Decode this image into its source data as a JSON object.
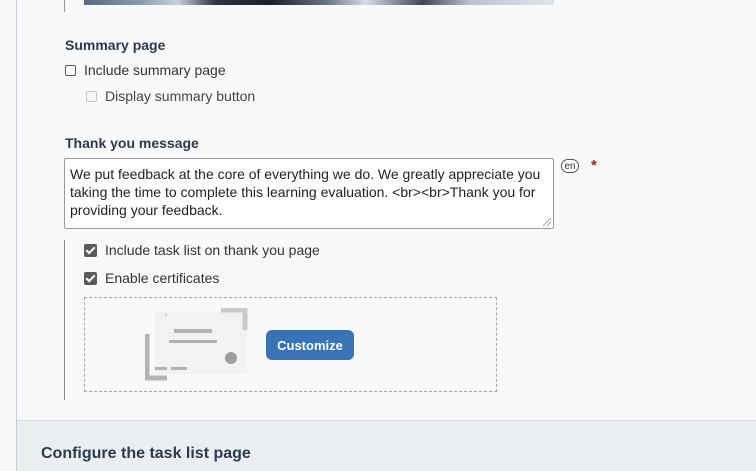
{
  "summary_section": {
    "title": "Summary page",
    "include_summary_label": "Include summary page",
    "display_button_label": "Display summary button"
  },
  "thank_you_section": {
    "title": "Thank you message",
    "message": "We put feedback at the core of everything we do. We greatly appreciate you taking the time to complete this learning evaluation. <br><br>Thank you for providing your feedback.",
    "language_badge": "en",
    "required_marker": "*",
    "include_task_list_label": "Include task list on thank you page",
    "enable_certificates_label": "Enable certificates",
    "customize_label": "Customize"
  },
  "task_list_section": {
    "title": "Configure the task list page"
  },
  "colors": {
    "accent": "#3973b5",
    "heading": "#2a3a4f",
    "required": "#8b2a1e"
  },
  "icons": [
    "checkbox",
    "resize-grip-icon",
    "certificate-icon"
  ]
}
